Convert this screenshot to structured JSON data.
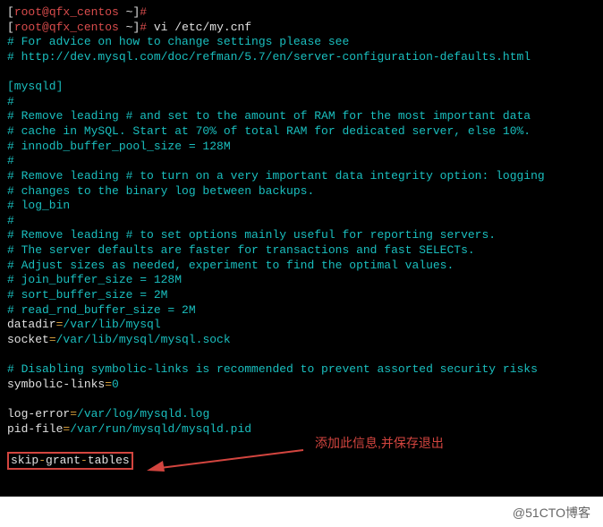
{
  "prompt": {
    "open": "[",
    "user_host": "root@qfx_centos",
    "path": " ~",
    "close": "]",
    "symbol": "#"
  },
  "cmd1": " vi /etc/my.cnf",
  "comments": {
    "c1": "# For advice on how to change settings please see",
    "c2": "# http://dev.mysql.com/doc/refman/5.7/en/server-configuration-defaults.html",
    "section": "[mysqld]",
    "hash": "#",
    "c3": "# Remove leading # and set to the amount of RAM for the most important data",
    "c4": "# cache in MySQL. Start at 70% of total RAM for dedicated server, else 10%.",
    "c5": "# innodb_buffer_pool_size = 128M",
    "c6": "# Remove leading # to turn on a very important data integrity option: logging",
    "c7": "# changes to the binary log between backups.",
    "c8": "# log_bin",
    "c9": "# Remove leading # to set options mainly useful for reporting servers.",
    "c10": "# The server defaults are faster for transactions and fast SELECTs.",
    "c11": "# Adjust sizes as needed, experiment to find the optimal values.",
    "c12": "# join_buffer_size = 128M",
    "c13": "# sort_buffer_size = 2M",
    "c14": "# read_rnd_buffer_size = 2M",
    "c15": "# Disabling symbolic-links is recommended to prevent assorted security risks"
  },
  "kv": {
    "datadir_k": "datadir",
    "datadir_v": "/var/lib/mysql",
    "socket_k": "socket",
    "socket_v": "/var/lib/mysql/mysql.sock",
    "sym_k": "symbolic-links",
    "sym_v": "0",
    "log_k": "log-error",
    "log_v": "/var/log/mysqld.log",
    "pid_k": "pid-file",
    "pid_v": "/var/run/mysqld/mysqld.pid"
  },
  "op": "=",
  "skip": {
    "w1": "skip",
    "d": "-",
    "w2": "grant",
    "w3": "tables"
  },
  "callout": "添加此信息,并保存退出",
  "watermark": "@51CTO博客"
}
